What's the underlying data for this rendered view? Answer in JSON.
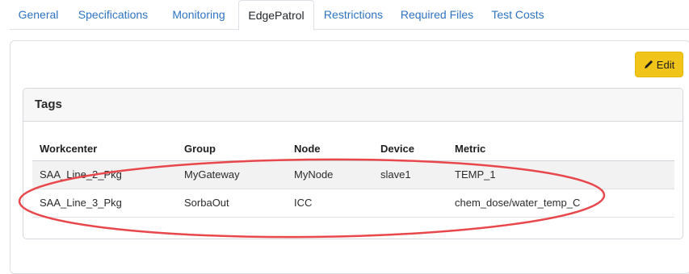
{
  "tabs": [
    {
      "label": "General"
    },
    {
      "label": "Specifications"
    },
    {
      "label": "Monitoring"
    },
    {
      "label": "EdgePatrol"
    },
    {
      "label": "Restrictions"
    },
    {
      "label": "Required Files"
    },
    {
      "label": "Test Costs"
    }
  ],
  "active_tab": "EdgePatrol",
  "edit_button": {
    "label": "Edit",
    "icon": "pencil-icon",
    "color": "#f0c418"
  },
  "tags": {
    "title": "Tags",
    "columns": [
      "Workcenter",
      "Group",
      "Node",
      "Device",
      "Metric"
    ],
    "rows": [
      [
        "SAA_Line_2_Pkg",
        "MyGateway",
        "MyNode",
        "slave1",
        "TEMP_1"
      ],
      [
        "SAA_Line_3_Pkg",
        "SorbaOut",
        "ICC",
        "",
        "chem_dose/water_temp_C"
      ]
    ]
  },
  "colors": {
    "link": "#2f73c2",
    "annotation": "#e8474c"
  }
}
